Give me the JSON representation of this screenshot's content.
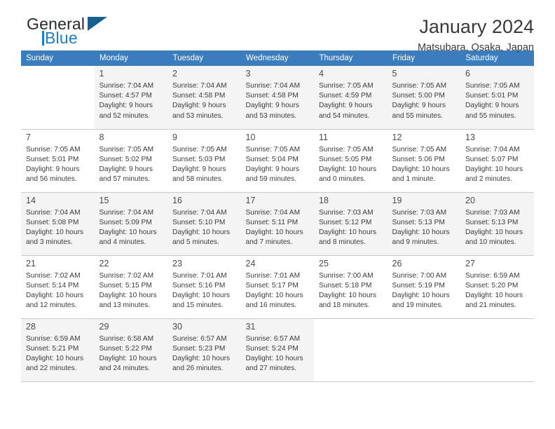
{
  "brand": {
    "word1": "General",
    "word2": "Blue",
    "triangle_color": "#16628f",
    "blue": "#1f7ec1"
  },
  "header": {
    "title": "January 2024",
    "subtitle": "Matsubara, Osaka, Japan"
  },
  "theme": {
    "header_bg": "#3b7cbd",
    "header_text": "#ffffff",
    "row_shade": "#f4f4f4",
    "grid_line": "#c8c8c8"
  },
  "columns": [
    "Sunday",
    "Monday",
    "Tuesday",
    "Wednesday",
    "Thursday",
    "Friday",
    "Saturday"
  ],
  "labels": {
    "sunrise_prefix": "Sunrise:",
    "sunset_prefix": "Sunset:",
    "daylight_prefix": "Daylight:"
  },
  "weeks": [
    [
      {
        "day": "",
        "sunrise": "",
        "sunset": "",
        "daylight_line1": "",
        "daylight_line2": ""
      },
      {
        "day": "1",
        "sunrise": "Sunrise: 7:04 AM",
        "sunset": "Sunset: 4:57 PM",
        "daylight_line1": "Daylight: 9 hours",
        "daylight_line2": "and 52 minutes."
      },
      {
        "day": "2",
        "sunrise": "Sunrise: 7:04 AM",
        "sunset": "Sunset: 4:58 PM",
        "daylight_line1": "Daylight: 9 hours",
        "daylight_line2": "and 53 minutes."
      },
      {
        "day": "3",
        "sunrise": "Sunrise: 7:04 AM",
        "sunset": "Sunset: 4:58 PM",
        "daylight_line1": "Daylight: 9 hours",
        "daylight_line2": "and 53 minutes."
      },
      {
        "day": "4",
        "sunrise": "Sunrise: 7:05 AM",
        "sunset": "Sunset: 4:59 PM",
        "daylight_line1": "Daylight: 9 hours",
        "daylight_line2": "and 54 minutes."
      },
      {
        "day": "5",
        "sunrise": "Sunrise: 7:05 AM",
        "sunset": "Sunset: 5:00 PM",
        "daylight_line1": "Daylight: 9 hours",
        "daylight_line2": "and 55 minutes."
      },
      {
        "day": "6",
        "sunrise": "Sunrise: 7:05 AM",
        "sunset": "Sunset: 5:01 PM",
        "daylight_line1": "Daylight: 9 hours",
        "daylight_line2": "and 55 minutes."
      }
    ],
    [
      {
        "day": "7",
        "sunrise": "Sunrise: 7:05 AM",
        "sunset": "Sunset: 5:01 PM",
        "daylight_line1": "Daylight: 9 hours",
        "daylight_line2": "and 56 minutes."
      },
      {
        "day": "8",
        "sunrise": "Sunrise: 7:05 AM",
        "sunset": "Sunset: 5:02 PM",
        "daylight_line1": "Daylight: 9 hours",
        "daylight_line2": "and 57 minutes."
      },
      {
        "day": "9",
        "sunrise": "Sunrise: 7:05 AM",
        "sunset": "Sunset: 5:03 PM",
        "daylight_line1": "Daylight: 9 hours",
        "daylight_line2": "and 58 minutes."
      },
      {
        "day": "10",
        "sunrise": "Sunrise: 7:05 AM",
        "sunset": "Sunset: 5:04 PM",
        "daylight_line1": "Daylight: 9 hours",
        "daylight_line2": "and 59 minutes."
      },
      {
        "day": "11",
        "sunrise": "Sunrise: 7:05 AM",
        "sunset": "Sunset: 5:05 PM",
        "daylight_line1": "Daylight: 10 hours",
        "daylight_line2": "and 0 minutes."
      },
      {
        "day": "12",
        "sunrise": "Sunrise: 7:05 AM",
        "sunset": "Sunset: 5:06 PM",
        "daylight_line1": "Daylight: 10 hours",
        "daylight_line2": "and 1 minute."
      },
      {
        "day": "13",
        "sunrise": "Sunrise: 7:04 AM",
        "sunset": "Sunset: 5:07 PM",
        "daylight_line1": "Daylight: 10 hours",
        "daylight_line2": "and 2 minutes."
      }
    ],
    [
      {
        "day": "14",
        "sunrise": "Sunrise: 7:04 AM",
        "sunset": "Sunset: 5:08 PM",
        "daylight_line1": "Daylight: 10 hours",
        "daylight_line2": "and 3 minutes."
      },
      {
        "day": "15",
        "sunrise": "Sunrise: 7:04 AM",
        "sunset": "Sunset: 5:09 PM",
        "daylight_line1": "Daylight: 10 hours",
        "daylight_line2": "and 4 minutes."
      },
      {
        "day": "16",
        "sunrise": "Sunrise: 7:04 AM",
        "sunset": "Sunset: 5:10 PM",
        "daylight_line1": "Daylight: 10 hours",
        "daylight_line2": "and 5 minutes."
      },
      {
        "day": "17",
        "sunrise": "Sunrise: 7:04 AM",
        "sunset": "Sunset: 5:11 PM",
        "daylight_line1": "Daylight: 10 hours",
        "daylight_line2": "and 7 minutes."
      },
      {
        "day": "18",
        "sunrise": "Sunrise: 7:03 AM",
        "sunset": "Sunset: 5:12 PM",
        "daylight_line1": "Daylight: 10 hours",
        "daylight_line2": "and 8 minutes."
      },
      {
        "day": "19",
        "sunrise": "Sunrise: 7:03 AM",
        "sunset": "Sunset: 5:13 PM",
        "daylight_line1": "Daylight: 10 hours",
        "daylight_line2": "and 9 minutes."
      },
      {
        "day": "20",
        "sunrise": "Sunrise: 7:03 AM",
        "sunset": "Sunset: 5:13 PM",
        "daylight_line1": "Daylight: 10 hours",
        "daylight_line2": "and 10 minutes."
      }
    ],
    [
      {
        "day": "21",
        "sunrise": "Sunrise: 7:02 AM",
        "sunset": "Sunset: 5:14 PM",
        "daylight_line1": "Daylight: 10 hours",
        "daylight_line2": "and 12 minutes."
      },
      {
        "day": "22",
        "sunrise": "Sunrise: 7:02 AM",
        "sunset": "Sunset: 5:15 PM",
        "daylight_line1": "Daylight: 10 hours",
        "daylight_line2": "and 13 minutes."
      },
      {
        "day": "23",
        "sunrise": "Sunrise: 7:01 AM",
        "sunset": "Sunset: 5:16 PM",
        "daylight_line1": "Daylight: 10 hours",
        "daylight_line2": "and 15 minutes."
      },
      {
        "day": "24",
        "sunrise": "Sunrise: 7:01 AM",
        "sunset": "Sunset: 5:17 PM",
        "daylight_line1": "Daylight: 10 hours",
        "daylight_line2": "and 16 minutes."
      },
      {
        "day": "25",
        "sunrise": "Sunrise: 7:00 AM",
        "sunset": "Sunset: 5:18 PM",
        "daylight_line1": "Daylight: 10 hours",
        "daylight_line2": "and 18 minutes."
      },
      {
        "day": "26",
        "sunrise": "Sunrise: 7:00 AM",
        "sunset": "Sunset: 5:19 PM",
        "daylight_line1": "Daylight: 10 hours",
        "daylight_line2": "and 19 minutes."
      },
      {
        "day": "27",
        "sunrise": "Sunrise: 6:59 AM",
        "sunset": "Sunset: 5:20 PM",
        "daylight_line1": "Daylight: 10 hours",
        "daylight_line2": "and 21 minutes."
      }
    ],
    [
      {
        "day": "28",
        "sunrise": "Sunrise: 6:59 AM",
        "sunset": "Sunset: 5:21 PM",
        "daylight_line1": "Daylight: 10 hours",
        "daylight_line2": "and 22 minutes."
      },
      {
        "day": "29",
        "sunrise": "Sunrise: 6:58 AM",
        "sunset": "Sunset: 5:22 PM",
        "daylight_line1": "Daylight: 10 hours",
        "daylight_line2": "and 24 minutes."
      },
      {
        "day": "30",
        "sunrise": "Sunrise: 6:57 AM",
        "sunset": "Sunset: 5:23 PM",
        "daylight_line1": "Daylight: 10 hours",
        "daylight_line2": "and 26 minutes."
      },
      {
        "day": "31",
        "sunrise": "Sunrise: 6:57 AM",
        "sunset": "Sunset: 5:24 PM",
        "daylight_line1": "Daylight: 10 hours",
        "daylight_line2": "and 27 minutes."
      },
      {
        "day": "",
        "sunrise": "",
        "sunset": "",
        "daylight_line1": "",
        "daylight_line2": ""
      },
      {
        "day": "",
        "sunrise": "",
        "sunset": "",
        "daylight_line1": "",
        "daylight_line2": ""
      },
      {
        "day": "",
        "sunrise": "",
        "sunset": "",
        "daylight_line1": "",
        "daylight_line2": ""
      }
    ]
  ]
}
